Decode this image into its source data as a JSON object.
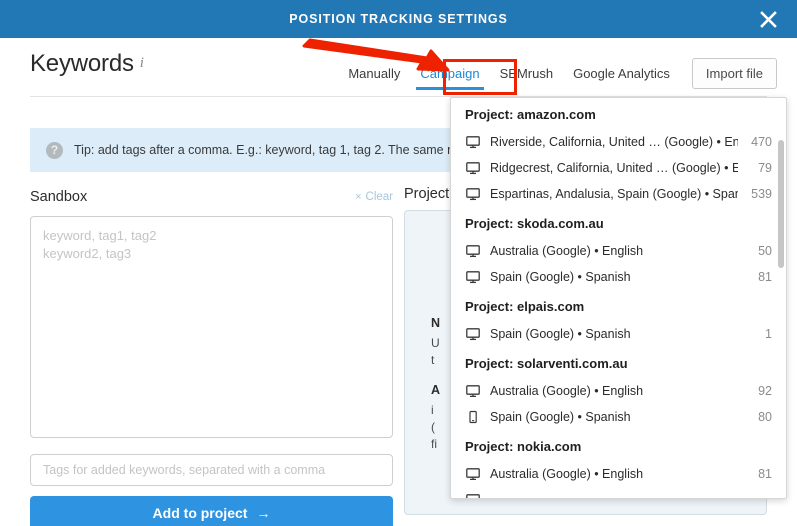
{
  "titlebar": {
    "title": "POSITION TRACKING SETTINGS",
    "close_icon": "close-icon"
  },
  "header": {
    "page_title": "Keywords",
    "info_icon": "i",
    "tabs": [
      {
        "label": "Manually",
        "active": false
      },
      {
        "label": "Campaign",
        "active": true
      },
      {
        "label": "SEMrush",
        "active": false
      },
      {
        "label": "Google Analytics",
        "active": false
      }
    ],
    "import_button": "Import file"
  },
  "annotation": {
    "arrow_color": "#ef2200",
    "highlight_color": "#ef2200",
    "highlight_target": "Campaign"
  },
  "tip": {
    "icon": "?",
    "text": "Tip: add tags after a comma. E.g.: keyword, tag 1, tag 2. The same rules"
  },
  "sandbox": {
    "label": "Sandbox",
    "clear_label": "Clear",
    "clear_icon": "×",
    "textarea_placeholder": "keyword, tag1, tag2\nkeyword2, tag3",
    "tags_placeholder": "Tags for added keywords, separated with a comma",
    "add_button": "Add to project",
    "add_button_arrow": "→"
  },
  "right_panel": {
    "label": "Project'",
    "heading_1": "N",
    "body_1_line1": "U",
    "body_1_line2": "t",
    "heading_2": "A",
    "body_2_line1": "i",
    "body_2_line2": "(",
    "body_2_line3": "fi"
  },
  "dropdown": {
    "accent_color": "#2e8fd8",
    "scrollbar_visible": true,
    "groups": [
      {
        "project": "Project: amazon.com",
        "rows": [
          {
            "device": "desktop-icon",
            "label": "Riverside, California, United …  (Google) • English",
            "count": "470"
          },
          {
            "device": "desktop-icon",
            "label": "Ridgecrest, California, United … (Google) • English",
            "count": "79"
          },
          {
            "device": "desktop-icon",
            "label": "Espartinas, Andalusia, Spain (Google) • Spanish",
            "count": "539"
          }
        ]
      },
      {
        "project": "Project: skoda.com.au",
        "rows": [
          {
            "device": "desktop-icon",
            "label": "Australia (Google) • English",
            "count": "50"
          },
          {
            "device": "desktop-icon",
            "label": "Spain (Google) • Spanish",
            "count": "81"
          }
        ]
      },
      {
        "project": "Project: elpais.com",
        "rows": [
          {
            "device": "desktop-icon",
            "label": "Spain (Google) • Spanish",
            "count": "1"
          }
        ]
      },
      {
        "project": "Project: solarventi.com.au",
        "rows": [
          {
            "device": "desktop-icon",
            "label": "Australia (Google) • English",
            "count": "92"
          },
          {
            "device": "mobile-icon",
            "label": "Spain (Google) • Spanish",
            "count": "80"
          }
        ]
      },
      {
        "project": "Project: nokia.com",
        "rows": [
          {
            "device": "desktop-icon",
            "label": "Australia (Google) • English",
            "count": "81"
          },
          {
            "device": "desktop-icon",
            "label": "",
            "count": ""
          }
        ]
      }
    ]
  }
}
